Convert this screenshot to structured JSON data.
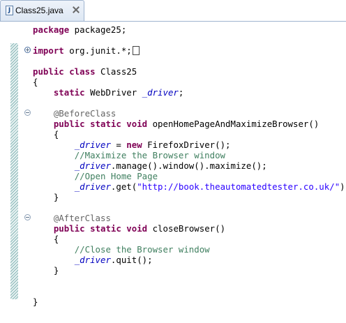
{
  "tab": {
    "title": "Class25.java",
    "file_icon": "java-file-icon",
    "close_icon": "close-icon"
  },
  "code": {
    "package_kw": "package",
    "package_name": " package25;",
    "import_kw": "import",
    "import_rest": " org.junit.*;",
    "class_public": "public",
    "class_kw": " class",
    "class_name": " Class25",
    "open_brace": "{",
    "close_brace": "}",
    "field_static": "static",
    "field_type": " WebDriver ",
    "driver": "_driver",
    "semicolon": ";",
    "before_ann": "@BeforeClass",
    "m1_public": "public",
    "m1_static": " static",
    "m1_void": " void",
    "m1_name": " openHomePageAndMaximizeBrowser()",
    "assign": " = ",
    "new_kw": "new",
    "ctor": " FirefoxDriver();",
    "c1": "//Maximize the Browser window",
    "manage": ".manage().window().maximize();",
    "c2": "//Open Home Page",
    "get_open": ".get(",
    "url": "\"http://book.theautomatedtester.co.uk/\"",
    "get_close": ");",
    "after_ann": "@AfterClass",
    "m2_public": "public",
    "m2_static": " static",
    "m2_void": " void",
    "m2_name": " closeBrowser()",
    "c3": "//Close the Browser window",
    "quit": ".quit();"
  },
  "colors": {
    "keyword": "#7f0055",
    "field": "#0000c0",
    "annotation": "#646464",
    "comment": "#3f7f5f",
    "string": "#2a00ff"
  }
}
